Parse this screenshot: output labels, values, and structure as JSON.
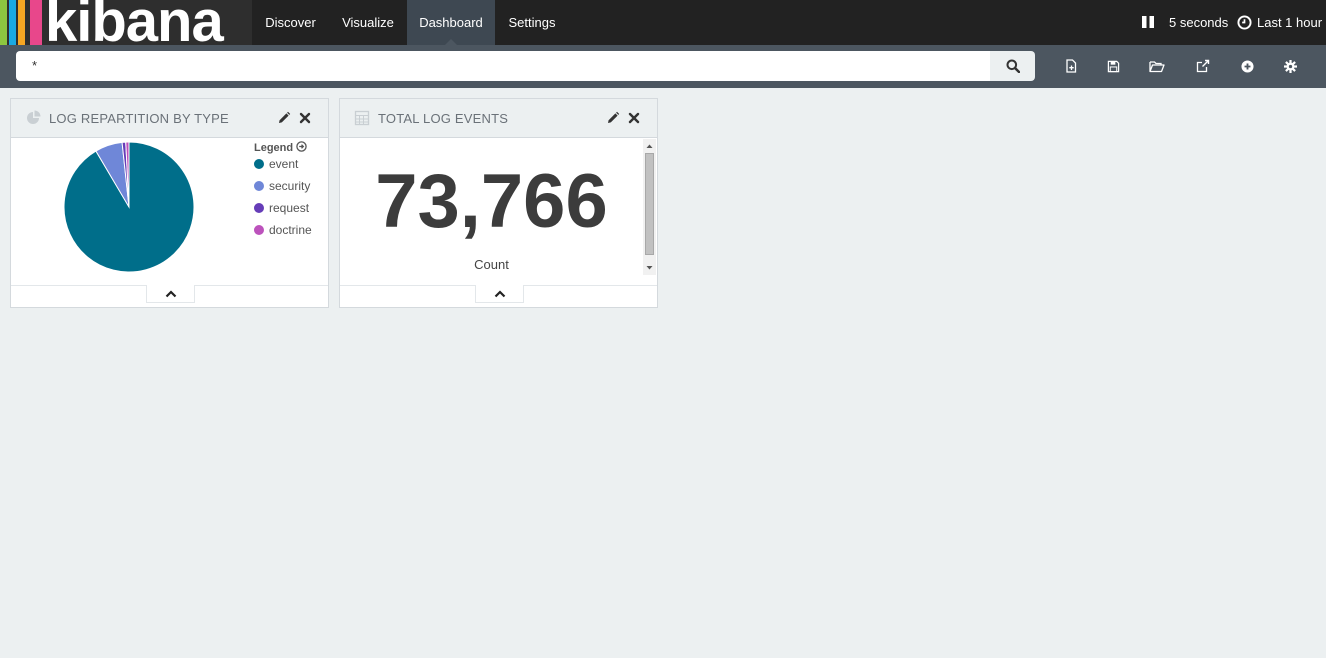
{
  "app": {
    "logo_text": "kibana",
    "logo_bars": [
      "#8dc63f",
      "#1ba9e1",
      "#f5a623",
      "#e8478b"
    ]
  },
  "nav": {
    "items": [
      {
        "label": "Discover"
      },
      {
        "label": "Visualize"
      },
      {
        "label": "Dashboard"
      },
      {
        "label": "Settings"
      }
    ],
    "active": "Dashboard",
    "refresh_interval": "5 seconds",
    "time_range": "Last 1 hour"
  },
  "search": {
    "query": "*"
  },
  "toolbar": {
    "icons": [
      "new-dashboard-icon",
      "save-icon",
      "open-icon",
      "share-icon",
      "add-panel-icon",
      "settings-icon"
    ]
  },
  "panels": {
    "pie": {
      "title": "LOG REPARTITION BY TYPE",
      "legend_title": "Legend",
      "legend": [
        {
          "label": "event",
          "color": "#006e8a"
        },
        {
          "label": "security",
          "color": "#6f87d8"
        },
        {
          "label": "request",
          "color": "#663db8"
        },
        {
          "label": "doctrine",
          "color": "#bc52bc"
        }
      ]
    },
    "metric": {
      "title": "TOTAL LOG EVENTS",
      "value": "73,766",
      "label": "Count"
    }
  },
  "chart_data": {
    "type": "pie",
    "title": "LOG REPARTITION BY TYPE",
    "categories": [
      "event",
      "security",
      "request",
      "doctrine"
    ],
    "values": [
      91.5,
      6.8,
      0.9,
      0.8
    ],
    "colors": [
      "#006e8a",
      "#6f87d8",
      "#663db8",
      "#bc52bc"
    ],
    "legend_position": "right"
  }
}
